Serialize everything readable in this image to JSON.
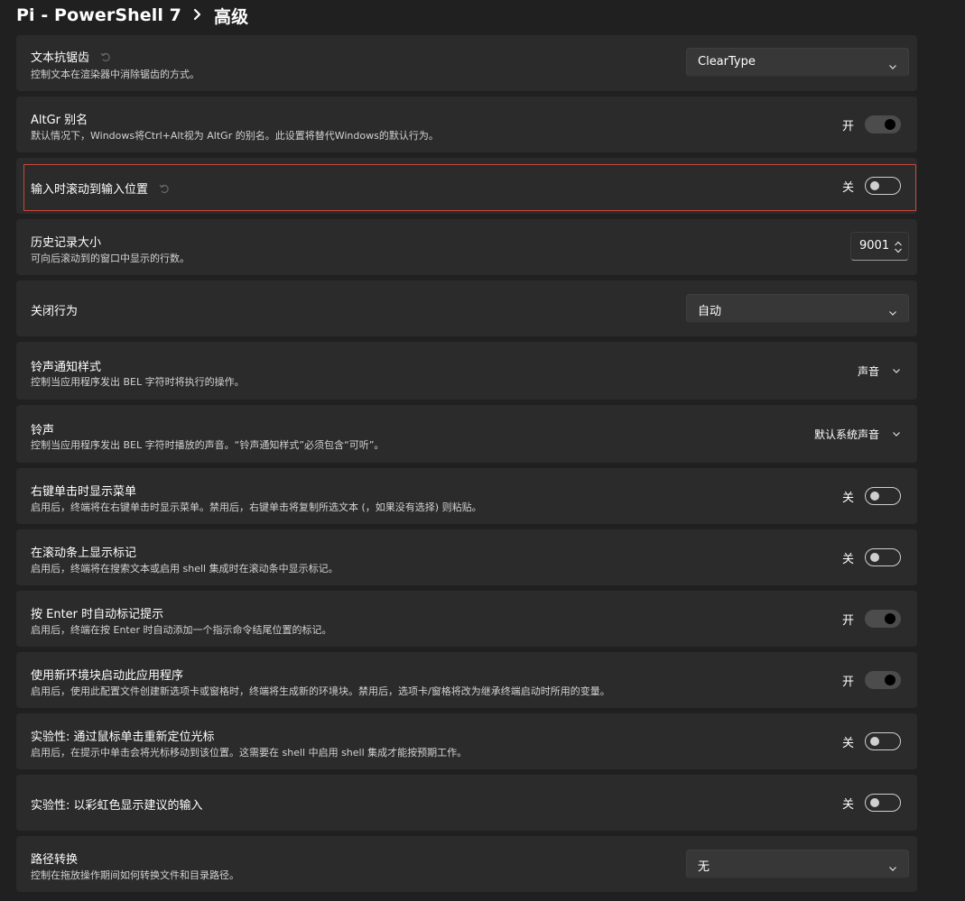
{
  "breadcrumb": {
    "profile": "Pi - PowerShell 7",
    "page": "高级"
  },
  "settings": {
    "antialias": {
      "title": "文本抗锯齿",
      "desc": "控制文本在渲染器中消除锯齿的方式。",
      "value": "ClearType"
    },
    "altgr": {
      "title": "AltGr 别名",
      "desc": "默认情况下，Windows将Ctrl+Alt视为 AltGr 的别名。此设置将替代Windows的默认行为。",
      "state": "开"
    },
    "scroll_on_input": {
      "title": "输入时滚动到输入位置",
      "state": "关"
    },
    "history": {
      "title": "历史记录大小",
      "desc": "可向后滚动到的窗口中显示的行数。",
      "value": "9001"
    },
    "close_behavior": {
      "title": "关闭行为",
      "value": "自动"
    },
    "bell_style": {
      "title": "铃声通知样式",
      "desc": "控制当应用程序发出 BEL 字符时将执行的操作。",
      "value": "声音"
    },
    "bell_sound": {
      "title": "铃声",
      "desc": "控制当应用程序发出 BEL 字符时播放的声音。“铃声通知样式”必须包含“可听”。",
      "value": "默认系统声音"
    },
    "right_click_menu": {
      "title": "右键单击时显示菜单",
      "desc": "启用后，终端将在右键单击时显示菜单。禁用后，右键单击将复制所选文本 (，如果没有选择) 则粘贴。",
      "state": "关"
    },
    "scrollbar_marks": {
      "title": "在滚动条上显示标记",
      "desc": "启用后，终端将在搜索文本或启用 shell 集成时在滚动条中显示标记。",
      "state": "关"
    },
    "auto_mark": {
      "title": "按 Enter 时自动标记提示",
      "desc": "启用后，终端在按 Enter 时自动添加一个指示命令结尾位置的标记。",
      "state": "开"
    },
    "new_env": {
      "title": "使用新环境块启动此应用程序",
      "desc": "启用后，使用此配置文件创建新选项卡或窗格时，终端将生成新的环境块。禁用后，选项卡/窗格将改为继承终端启动时所用的变量。",
      "state": "开"
    },
    "reposition_cursor": {
      "title": "实验性: 通过鼠标单击重新定位光标",
      "desc": "启用后，在提示中单击会将光标移动到该位置。这需要在 shell 中启用 shell 集成才能按预期工作。",
      "state": "关"
    },
    "rainbow": {
      "title": "实验性: 以彩虹色显示建议的输入",
      "state": "关"
    },
    "path_translation": {
      "title": "路径转换",
      "desc": "控制在拖放操作期间如何转换文件和目录路径。",
      "value": "无"
    }
  },
  "colors": {
    "background": "#202020",
    "card": "#2b2b2b",
    "focus": "#c9473b"
  },
  "icons": {
    "reset": "reset-icon",
    "dropdown": "chevron-down-icon",
    "spin": "spin-arrows-icon"
  }
}
